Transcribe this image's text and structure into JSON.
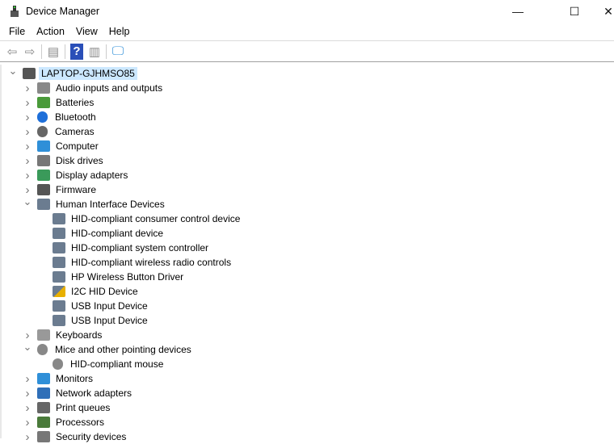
{
  "window": {
    "title": "Device Manager",
    "minimize": "—",
    "maximize": "☐",
    "close": "✕"
  },
  "menu": [
    "File",
    "Action",
    "View",
    "Help"
  ],
  "toolbar": [
    {
      "icon": "back-arrow-icon",
      "glyph": "⇦"
    },
    {
      "icon": "forward-arrow-icon",
      "glyph": "⇨"
    },
    {
      "icon": "properties-icon",
      "glyph": "▤"
    },
    {
      "icon": "help-icon",
      "glyph": "?"
    },
    {
      "icon": "update-driver-icon",
      "glyph": "▥"
    },
    {
      "icon": "scan-hardware-icon",
      "glyph": "🖵"
    }
  ],
  "tree": [
    {
      "label": "LAPTOP-GJHMSO85",
      "level": 0,
      "state": "expanded",
      "icon": "computer-root",
      "color": "#555555",
      "selected": true
    },
    {
      "label": "Audio inputs and outputs",
      "level": 1,
      "state": "collapsed",
      "icon": "speaker",
      "color": "#888888"
    },
    {
      "label": "Batteries",
      "level": 1,
      "state": "collapsed",
      "icon": "battery",
      "color": "#4a9a3a"
    },
    {
      "label": "Bluetooth",
      "level": 1,
      "state": "collapsed",
      "icon": "bluetooth",
      "color": "#1e6fd9"
    },
    {
      "label": "Cameras",
      "level": 1,
      "state": "collapsed",
      "icon": "camera",
      "color": "#666666"
    },
    {
      "label": "Computer",
      "level": 1,
      "state": "collapsed",
      "icon": "monitor",
      "color": "#2f8fd8"
    },
    {
      "label": "Disk drives",
      "level": 1,
      "state": "collapsed",
      "icon": "disk",
      "color": "#777777"
    },
    {
      "label": "Display adapters",
      "level": 1,
      "state": "collapsed",
      "icon": "display-adapter",
      "color": "#3a9a5a"
    },
    {
      "label": "Firmware",
      "level": 1,
      "state": "collapsed",
      "icon": "firmware",
      "color": "#555555"
    },
    {
      "label": "Human Interface Devices",
      "level": 1,
      "state": "expanded",
      "icon": "hid",
      "color": "#6b7c90"
    },
    {
      "label": "HID-compliant consumer control device",
      "level": 2,
      "icon": "hid",
      "color": "#6b7c90"
    },
    {
      "label": "HID-compliant device",
      "level": 2,
      "icon": "hid",
      "color": "#6b7c90"
    },
    {
      "label": "HID-compliant system controller",
      "level": 2,
      "icon": "hid",
      "color": "#6b7c90"
    },
    {
      "label": "HID-compliant wireless radio controls",
      "level": 2,
      "icon": "hid",
      "color": "#6b7c90"
    },
    {
      "label": "HP Wireless Button Driver",
      "level": 2,
      "icon": "hid",
      "color": "#6b7c90"
    },
    {
      "label": "I2C HID Device",
      "level": 2,
      "icon": "hid-warning",
      "color": "#e8b000"
    },
    {
      "label": "USB Input Device",
      "level": 2,
      "icon": "hid",
      "color": "#6b7c90"
    },
    {
      "label": "USB Input Device",
      "level": 2,
      "icon": "hid",
      "color": "#6b7c90"
    },
    {
      "label": "Keyboards",
      "level": 1,
      "state": "collapsed",
      "icon": "keyboard",
      "color": "#999999"
    },
    {
      "label": "Mice and other pointing devices",
      "level": 1,
      "state": "expanded",
      "icon": "mouse",
      "color": "#888888"
    },
    {
      "label": "HID-compliant mouse",
      "level": 2,
      "icon": "mouse",
      "color": "#888888"
    },
    {
      "label": "Monitors",
      "level": 1,
      "state": "collapsed",
      "icon": "monitor",
      "color": "#2f8fd8"
    },
    {
      "label": "Network adapters",
      "level": 1,
      "state": "collapsed",
      "icon": "network",
      "color": "#2f6fb8"
    },
    {
      "label": "Print queues",
      "level": 1,
      "state": "collapsed",
      "icon": "printer",
      "color": "#666666"
    },
    {
      "label": "Processors",
      "level": 1,
      "state": "collapsed",
      "icon": "processor",
      "color": "#4a7a3a"
    },
    {
      "label": "Security devices",
      "level": 1,
      "state": "collapsed",
      "icon": "security",
      "color": "#777777"
    }
  ]
}
